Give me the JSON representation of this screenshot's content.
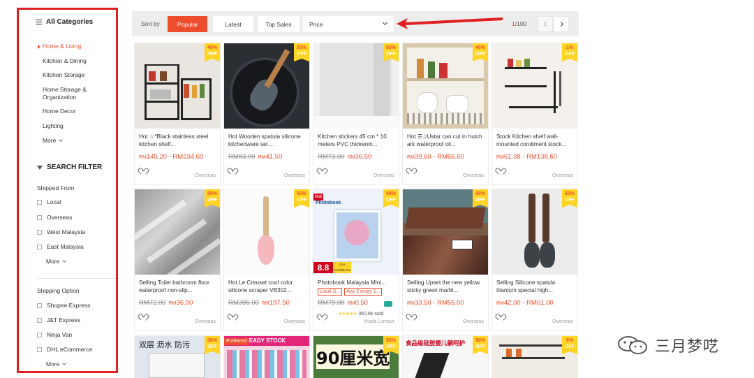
{
  "sidebar": {
    "categories_title": "All Categories",
    "categories": [
      {
        "label": "Home & Living",
        "active": true
      },
      {
        "label": "Kitchen & Dining",
        "active": false
      },
      {
        "label": "Kitchen Storage",
        "active": false
      },
      {
        "label": "Home Storage & Organization",
        "active": false
      },
      {
        "label": "Home Decor",
        "active": false
      },
      {
        "label": "Lighting",
        "active": false
      }
    ],
    "more_label": "More",
    "filter_title": "SEARCH FILTER",
    "shipped_from_title": "Shipped From",
    "shipped_from": [
      "Local",
      "Overseas",
      "West Malaysia",
      "East Malaysia"
    ],
    "shipping_option_title": "Shipping Option",
    "shipping_options": [
      "Shopee Express",
      "J&T Express",
      "Ninja Van",
      "DHL eCommerce"
    ]
  },
  "sortbar": {
    "label": "Sort by",
    "options": [
      "Popular",
      "Latest",
      "Top Sales"
    ],
    "active": "Popular",
    "price_label": "Price",
    "page_current": "1",
    "page_total": "/100"
  },
  "currency": "RM",
  "products": [
    {
      "name": "Hot ☆*Black stainless steel kitchen shelf...",
      "old": "",
      "price": "145.20 - RM234.60",
      "discount": "40%",
      "origin": "Overseas"
    },
    {
      "name": "Hot Wooden spatula silicone kitchenware set ...",
      "old": "RM83.00",
      "price": "41.50",
      "discount": "50%",
      "origin": "Overseas"
    },
    {
      "name": "Kitchen stickers 45 cm * 10 meters PVC thickenin...",
      "old": "RM73.00",
      "price": "36.50",
      "discount": "50%",
      "origin": "Overseas"
    },
    {
      "name": "Hot ☰♫Ustar can cut in hutch ark waterproof oil...",
      "old": "",
      "price": "39.60 - RM66.60",
      "discount": "40%",
      "origin": "Overseas"
    },
    {
      "name": "Stock Kitchen shelf wall-mounted condiment stock...",
      "old": "",
      "price": "61.38 - RM138.60",
      "discount": "1%",
      "origin": "Overseas"
    },
    {
      "name": "Selling Toilet bathroom floor waterproof non-slip...",
      "old": "RM72.00",
      "price": "36.00",
      "discount": "50%",
      "origin": "Overseas"
    },
    {
      "name": "Hot Le Creuset cool color silicone scraper VB302...",
      "old": "RM395.00",
      "price": "197.50",
      "discount": "50%",
      "origin": "Overseas"
    },
    {
      "name": "Photobook Malaysia Mini...",
      "old": "RM79.00",
      "price": "0.50",
      "discount": "99%",
      "origin": "Kuala Lumpur",
      "tags": [
        "Local S...",
        "Any 2 enjoy 1..."
      ],
      "sold": "360.8k sold"
    },
    {
      "name": "Selling Upset the new yellow sticky green marbl...",
      "old": "",
      "price": "33.50 - RM55.00",
      "discount": "50%",
      "origin": "Overseas"
    },
    {
      "name": "Selling Silicone spatula titanium special high...",
      "old": "",
      "price": "42.00 - RM61.00",
      "discount": "50%",
      "origin": "Overseas"
    }
  ],
  "bottom_row": [
    {
      "discount": "50%",
      "image_text": "双层 沥水 防污"
    },
    {
      "discount": "",
      "badge": "Preferred",
      "image_text": "READY STOCK"
    },
    {
      "discount": "50%",
      "image_text": "90厘米宽"
    },
    {
      "discount": "50%",
      "image_text": "食品级硅胶婴儿躺呵护"
    },
    {
      "discount": "5%",
      "image_text": ""
    }
  ],
  "photobook": {
    "mall": "Mall",
    "brand": "Photobook",
    "price_tag": "8.8",
    "cashback": "10% CASHBACK"
  },
  "watermark": "三月梦呓"
}
